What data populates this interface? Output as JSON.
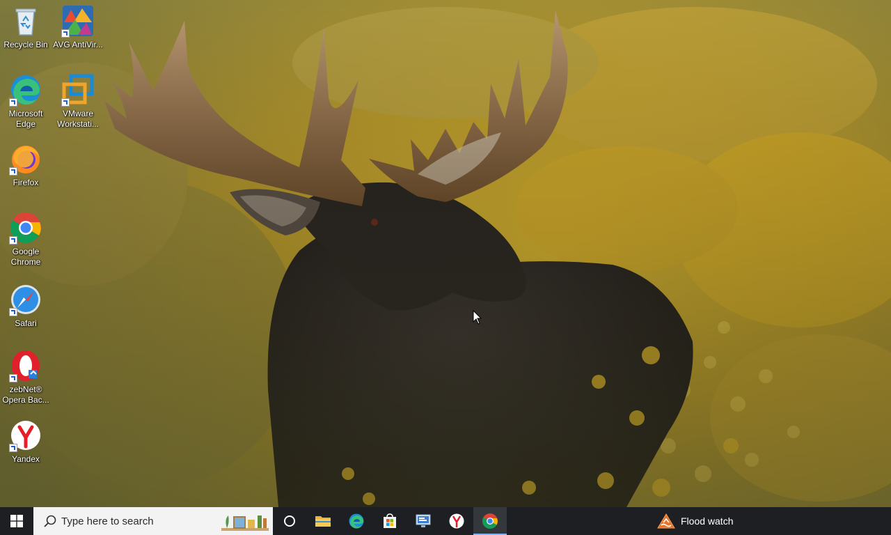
{
  "desktop": {
    "icons": [
      {
        "label": "Recycle Bin",
        "icon": "recycle-bin-icon",
        "shortcut": false
      },
      {
        "label": "AVG AntiVir...",
        "icon": "avg-antivirus-icon",
        "shortcut": true
      },
      {
        "label": "Microsoft Edge",
        "icon": "edge-icon",
        "shortcut": true
      },
      {
        "label": "VMware Workstati...",
        "icon": "vmware-icon",
        "shortcut": true
      },
      {
        "label": "Firefox",
        "icon": "firefox-icon",
        "shortcut": true
      },
      {
        "label": "Google Chrome",
        "icon": "chrome-icon",
        "shortcut": true
      },
      {
        "label": "Safari",
        "icon": "safari-icon",
        "shortcut": true
      },
      {
        "label": "zebNet® Opera Bac...",
        "icon": "zebnet-opera-icon",
        "shortcut": true
      },
      {
        "label": "Yandex",
        "icon": "yandex-icon",
        "shortcut": true
      }
    ]
  },
  "taskbar": {
    "search_placeholder": "Type here to search",
    "pinned": [
      {
        "name": "task-view",
        "icon": "task-view-icon"
      },
      {
        "name": "file-explorer",
        "icon": "folder-icon"
      },
      {
        "name": "edge",
        "icon": "edge-icon"
      },
      {
        "name": "store",
        "icon": "store-icon"
      },
      {
        "name": "remote-desktop",
        "icon": "monitor-icon"
      },
      {
        "name": "yandex",
        "icon": "yandex-icon"
      },
      {
        "name": "chrome",
        "icon": "chrome-icon",
        "active": true
      }
    ],
    "weather": {
      "label": "Flood watch",
      "icon": "warning-icon"
    }
  },
  "colors": {
    "taskbar_bg": "#1d1f22",
    "active_indicator": "#7fb5ea",
    "search_bg": "#f3f3f3"
  }
}
